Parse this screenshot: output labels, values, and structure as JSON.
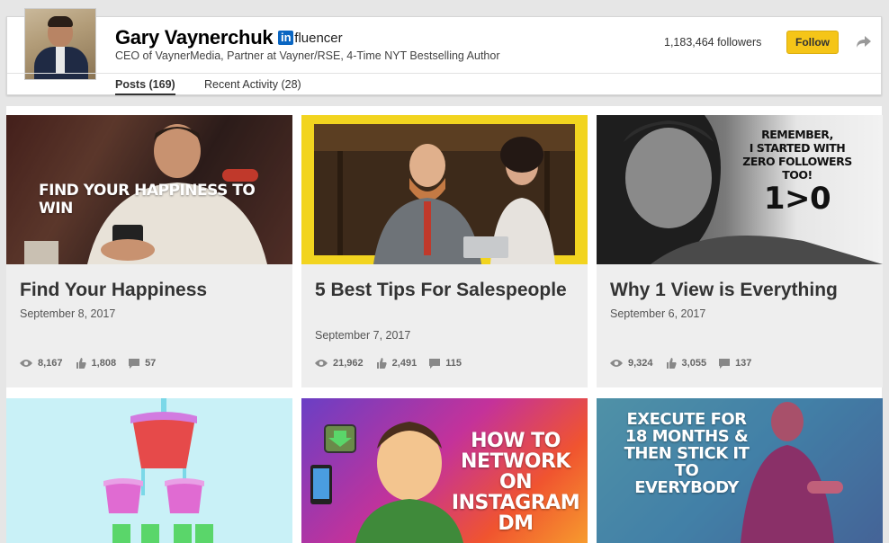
{
  "profile": {
    "name": "Gary Vaynerchuk",
    "badge_in": "in",
    "badge_text": "fluencer",
    "headline": "CEO of VaynerMedia, Partner at Vayner/RSE, 4-Time NYT Bestselling Author",
    "followers": "1,183,464 followers",
    "follow_label": "Follow"
  },
  "tabs": [
    {
      "label": "Posts (169)",
      "active": true
    },
    {
      "label": "Recent Activity (28)",
      "active": false
    }
  ],
  "posts": [
    {
      "thumb_text": "FIND YOUR HAPPINESS TO WIN",
      "title": "Find Your Happiness",
      "date": "September 8, 2017",
      "views": "8,167",
      "likes": "1,808",
      "comments": "57"
    },
    {
      "thumb_text": "",
      "title": "5 Best Tips For Salespeople",
      "date": "September 7, 2017",
      "views": "21,962",
      "likes": "2,491",
      "comments": "115"
    },
    {
      "thumb_text": "REMEMBER, I STARTED WITH ZERO FOLLOWERS TOO! 1>0",
      "thumb_lines": [
        "REMEMBER,",
        "I STARTED WITH",
        "ZERO FOLLOWERS TOO!",
        "1>0"
      ],
      "title": "Why 1 View is Everything",
      "date": "September 6, 2017",
      "views": "9,324",
      "likes": "3,055",
      "comments": "137"
    },
    {
      "thumb_text": ""
    },
    {
      "thumb_lines": [
        "HOW TO",
        "NETWORK ON",
        "INSTAGRAM",
        "DM"
      ]
    },
    {
      "thumb_lines": [
        "EXECUTE FOR",
        "18 MONTHS &",
        "THEN STICK IT",
        "TO EVERYBODY"
      ]
    }
  ],
  "colors": {
    "follow_button": "#f5c518",
    "linkedin_blue": "#0a66c2",
    "card_bg": "#eeeeee"
  }
}
